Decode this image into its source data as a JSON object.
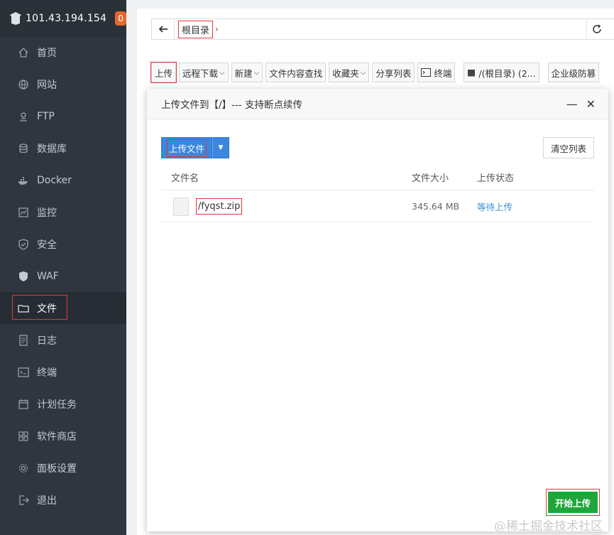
{
  "sidebar": {
    "ip": "101.43.194.154",
    "badge": "0",
    "items": [
      {
        "label": "首页",
        "icon": "home-icon"
      },
      {
        "label": "网站",
        "icon": "globe-icon"
      },
      {
        "label": "FTP",
        "icon": "ftp-icon"
      },
      {
        "label": "数据库",
        "icon": "database-icon"
      },
      {
        "label": "Docker",
        "icon": "docker-icon"
      },
      {
        "label": "监控",
        "icon": "monitor-icon"
      },
      {
        "label": "安全",
        "icon": "shield-icon"
      },
      {
        "label": "WAF",
        "icon": "waf-shield-icon"
      },
      {
        "label": "文件",
        "icon": "folder-icon"
      },
      {
        "label": "日志",
        "icon": "log-icon"
      },
      {
        "label": "终端",
        "icon": "terminal-icon"
      },
      {
        "label": "计划任务",
        "icon": "calendar-icon"
      },
      {
        "label": "软件商店",
        "icon": "apps-icon"
      },
      {
        "label": "面板设置",
        "icon": "gear-icon"
      },
      {
        "label": "退出",
        "icon": "logout-icon"
      }
    ]
  },
  "pathbar": {
    "crumb": "根目录",
    "sep": "›"
  },
  "toolbar": {
    "upload": "上传",
    "remote_download": "远程下载",
    "new": "新建",
    "content_search": "文件内容查找",
    "favorites": "收藏夹",
    "share_list": "分享列表",
    "terminal": "终端",
    "disk": "/(根目录) (2...",
    "enterprise": "企业级防篡"
  },
  "dialog": {
    "title": "上传文件到【/】--- 支持断点续传",
    "upload_file_btn": "上传文件",
    "clear_list_btn": "清空列表",
    "columns": {
      "name": "文件名",
      "size": "文件大小",
      "status": "上传状态"
    },
    "files": [
      {
        "name": "/fyqst.zip",
        "size": "345.64 MB",
        "status": "等待上传"
      }
    ],
    "start_btn": "开始上传"
  },
  "watermark": "@稀土掘金技术社区",
  "colors": {
    "sidebar_bg": "#2f3640",
    "accent_blue": "#3a87e0",
    "start_green": "#20a53a",
    "highlight_red": "#e0383e"
  }
}
